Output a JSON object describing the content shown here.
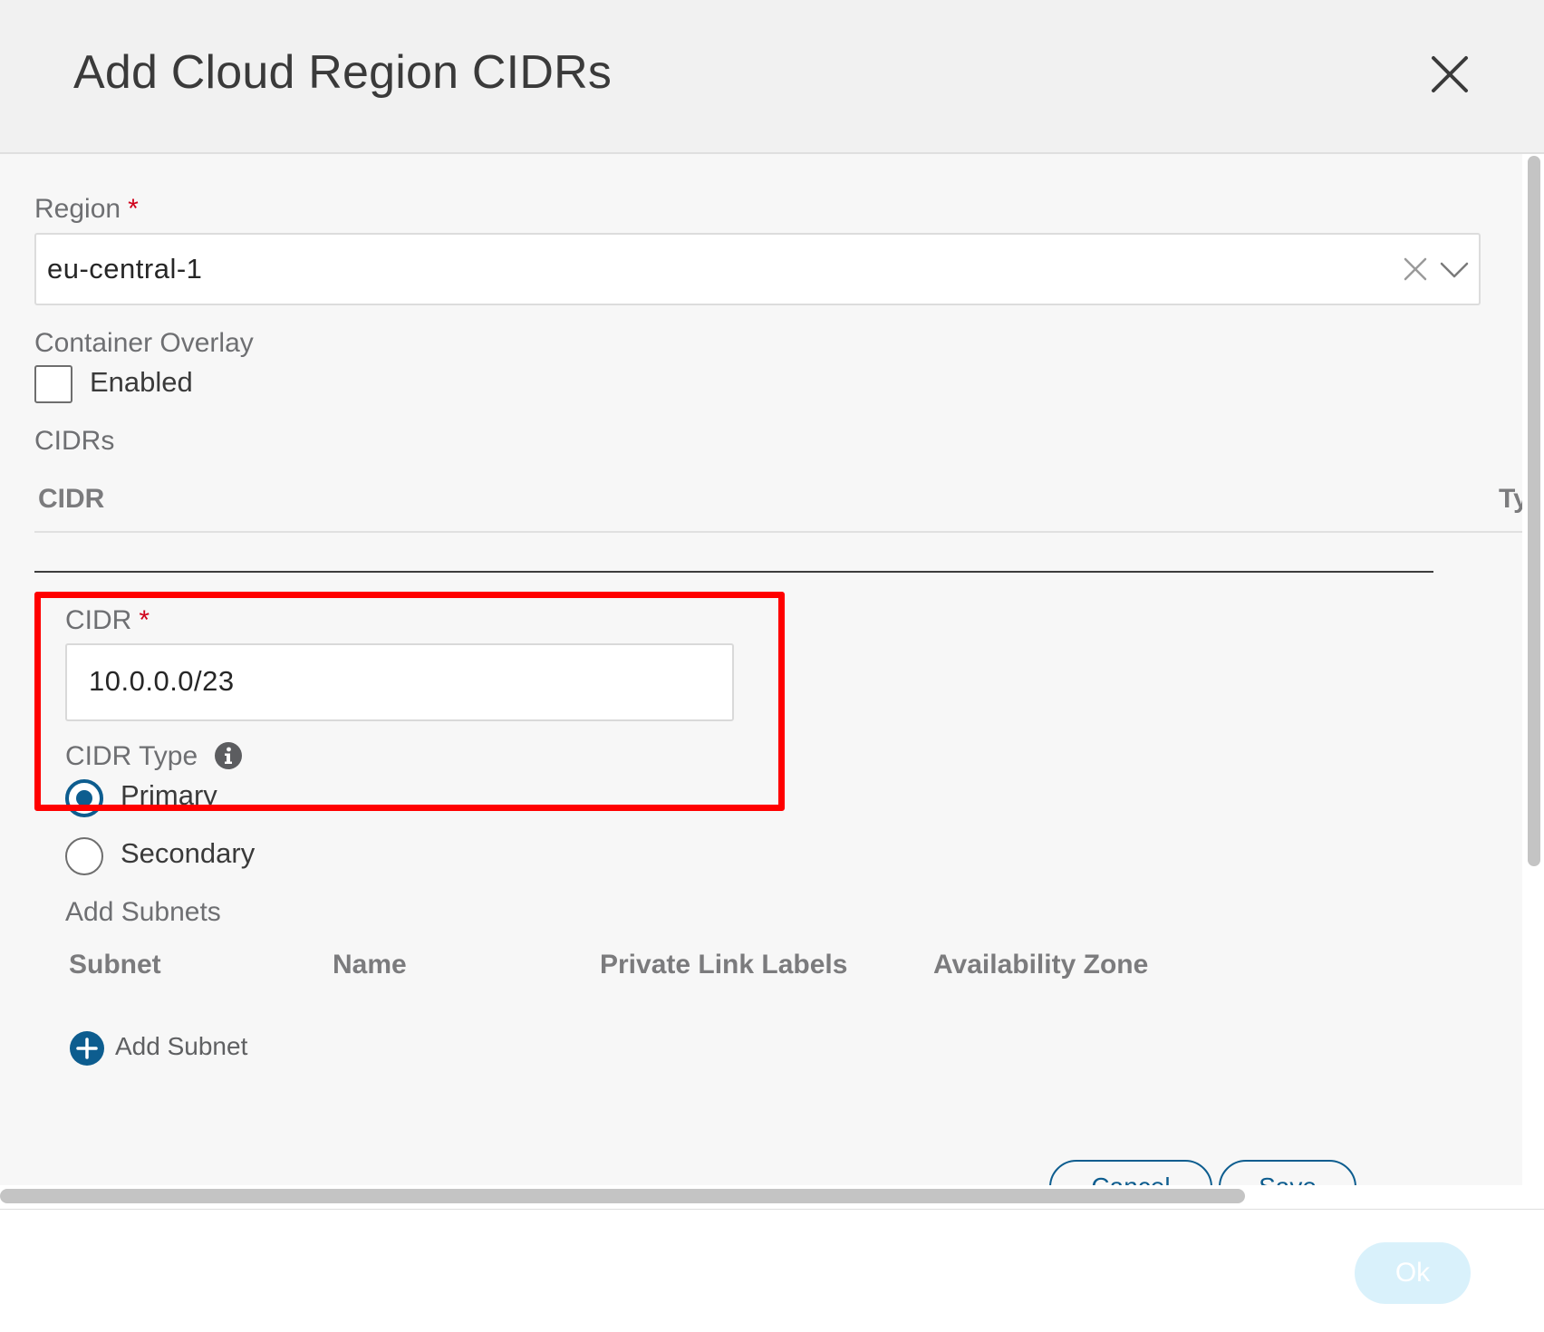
{
  "dialog": {
    "title": "Add Cloud Region CIDRs",
    "close_icon": "close-icon"
  },
  "form": {
    "region": {
      "label": "Region",
      "required_marker": "*",
      "value": "eu-central-1",
      "clear_icon": "clear-icon",
      "dropdown_icon": "chevron-down-icon"
    },
    "container_overlay": {
      "label": "Container Overlay",
      "checkbox_label": "Enabled",
      "checked": false
    },
    "cidrs": {
      "label": "CIDRs",
      "columns": [
        "CIDR",
        "Ty"
      ]
    },
    "cidr_editor": {
      "cidr_label": "CIDR",
      "required_marker": "*",
      "cidr_value": "10.0.0.0/23",
      "type_label": "CIDR Type",
      "info_icon": "info-icon",
      "type_options": [
        {
          "label": "Primary",
          "selected": true
        },
        {
          "label": "Secondary",
          "selected": false
        }
      ],
      "subnets": {
        "label": "Add Subnets",
        "columns": [
          "Subnet",
          "Name",
          "Private Link Labels",
          "Availability Zone"
        ],
        "add_label": "Add Subnet",
        "add_icon": "plus-circle-icon"
      },
      "buttons": {
        "cancel": "Cancel",
        "save": "Save"
      }
    }
  },
  "footer": {
    "ok_label": "Ok"
  },
  "colors": {
    "accent": "#0d5d8f",
    "required": "#d0021b",
    "highlight": "#ff0000",
    "ok_disabled": "#d9f1fb"
  }
}
